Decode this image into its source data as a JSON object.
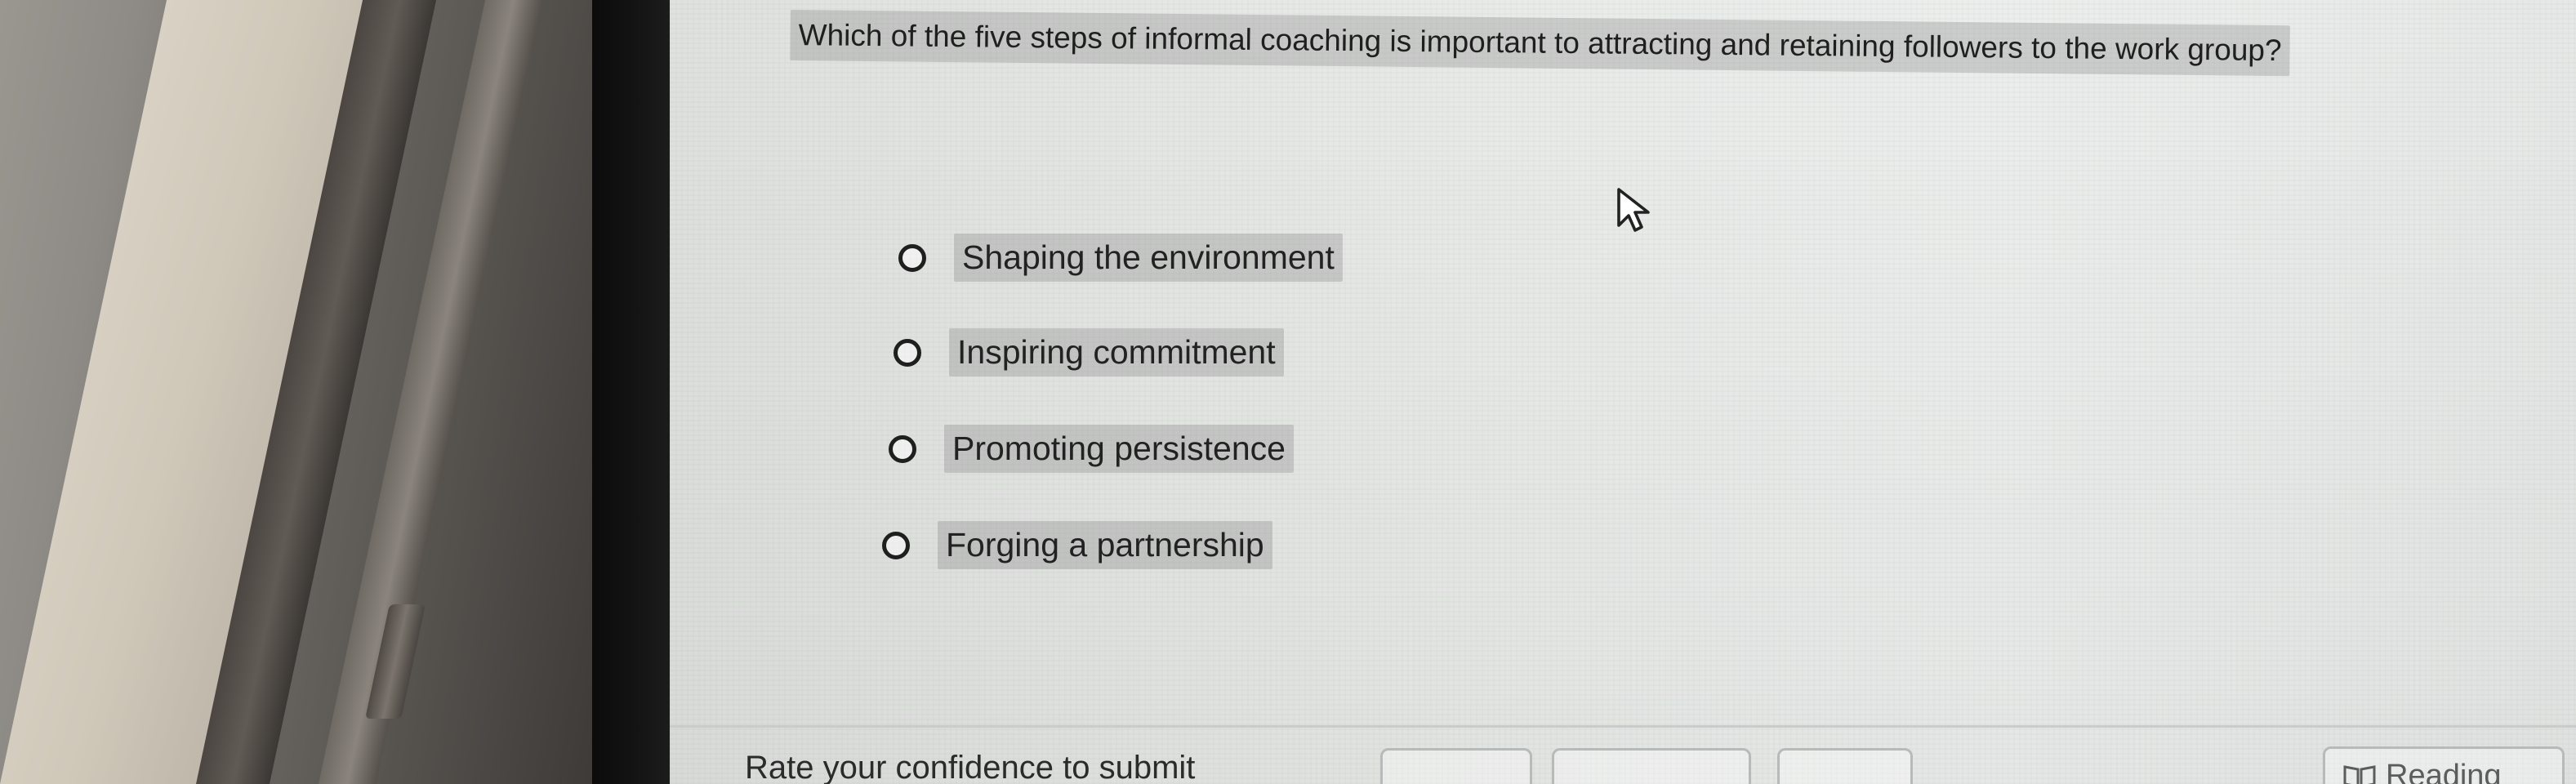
{
  "question": {
    "text": "Which of the five steps of informal coaching is important to attracting and retaining followers to the work group?"
  },
  "options": [
    {
      "label": "Shaping the environment",
      "selected": false
    },
    {
      "label": "Inspiring commitment",
      "selected": false
    },
    {
      "label": "Promoting persistence",
      "selected": false
    },
    {
      "label": "Forging a partnership",
      "selected": false
    }
  ],
  "footer": {
    "confidence_label": "Rate your confidence to submit",
    "reading_label": "Reading"
  },
  "icons": {
    "cursor": "mouse-pointer-icon",
    "reading": "book-icon"
  }
}
